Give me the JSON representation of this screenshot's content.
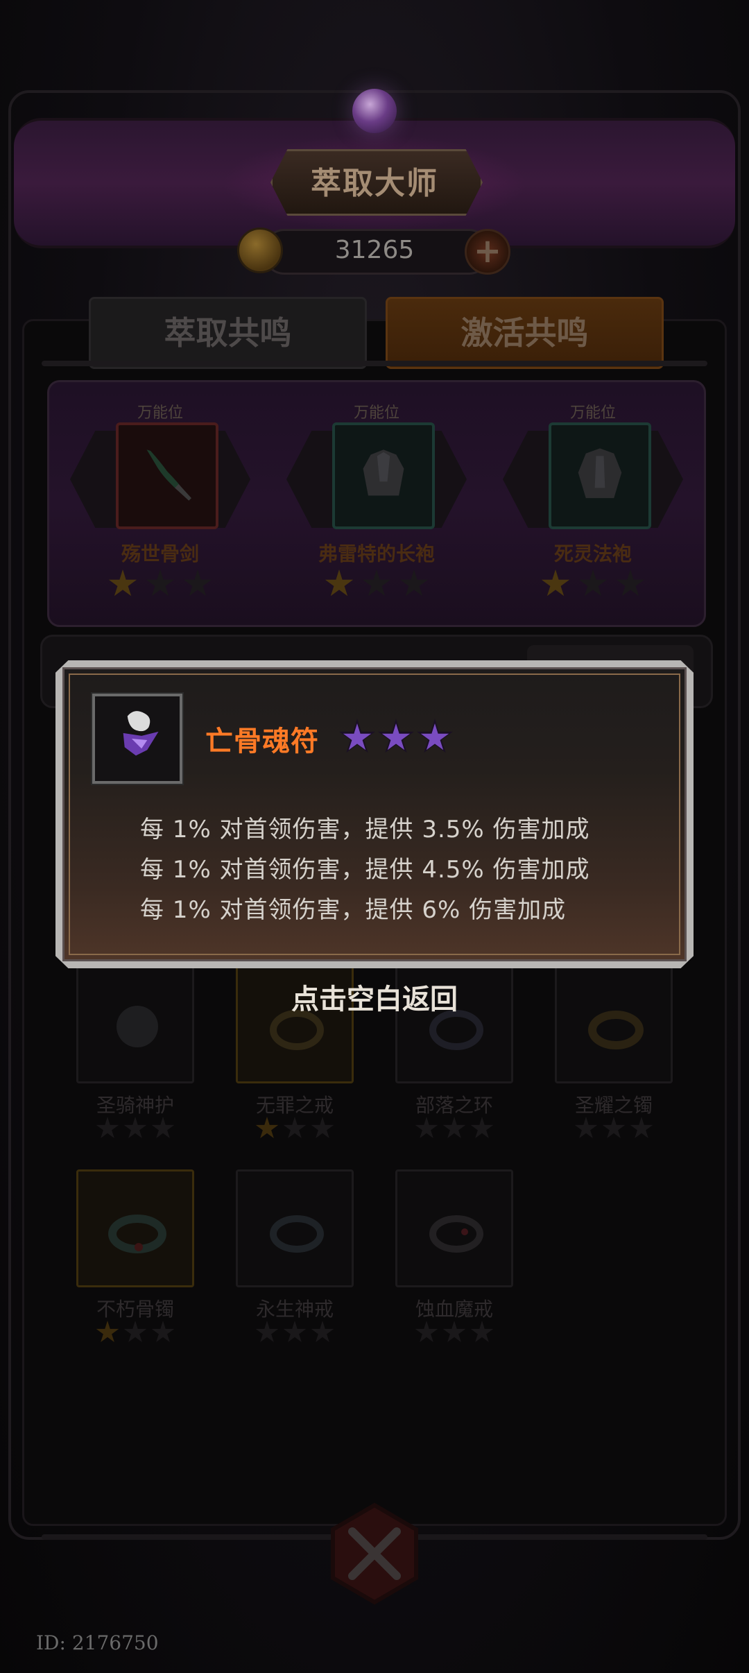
{
  "title": "萃取大师",
  "currency": {
    "value": "31265",
    "coin_icon": "gold-coin-icon",
    "plus_icon": "plus-icon"
  },
  "tabs": [
    {
      "label": "萃取共鸣",
      "active": false
    },
    {
      "label": "激活共鸣",
      "active": true
    }
  ],
  "equipped_slots": [
    {
      "caption": "万能位",
      "name": "殇世骨剑",
      "stars": 1,
      "max_stars": 3,
      "icon": "bone-sword-icon"
    },
    {
      "caption": "万能位",
      "name": "弗雷特的长袍",
      "stars": 1,
      "max_stars": 3,
      "icon": "robe-icon"
    },
    {
      "caption": "万能位",
      "name": "死灵法袍",
      "stars": 1,
      "max_stars": 3,
      "icon": "necro-robe-icon"
    }
  ],
  "items": [
    {
      "name": "圣骑神护",
      "stars": 0,
      "icon": "holy-amulet-icon",
      "frame": "normal"
    },
    {
      "name": "无罪之戒",
      "stars": 1,
      "icon": "ring-icon",
      "frame": "gold"
    },
    {
      "name": "部落之环",
      "stars": 0,
      "icon": "ring-icon",
      "frame": "normal"
    },
    {
      "name": "圣耀之镯",
      "stars": 0,
      "icon": "bracelet-icon",
      "frame": "normal"
    },
    {
      "name": "不朽骨镯",
      "stars": 1,
      "icon": "bracelet-icon",
      "frame": "gold"
    },
    {
      "name": "永生神戒",
      "stars": 0,
      "icon": "ring-icon",
      "frame": "normal"
    },
    {
      "name": "蚀血魔戒",
      "stars": 0,
      "icon": "ring-icon",
      "frame": "normal"
    }
  ],
  "popup": {
    "item_name": "亡骨魂符",
    "item_icon": "bone-soul-talisman-icon",
    "stars": 3,
    "star_color": "#7a4cc0",
    "name_color": "#ff7a26",
    "effects": [
      "每 1% 对首领伤害，提供 3.5% 伤害加成",
      "每 1% 对首领伤害，提供 4.5% 伤害加成",
      "每 1% 对首领伤害，提供 6% 伤害加成"
    ]
  },
  "return_hint": "点击空白返回",
  "footer": {
    "id_text": "ID: 2176750"
  }
}
